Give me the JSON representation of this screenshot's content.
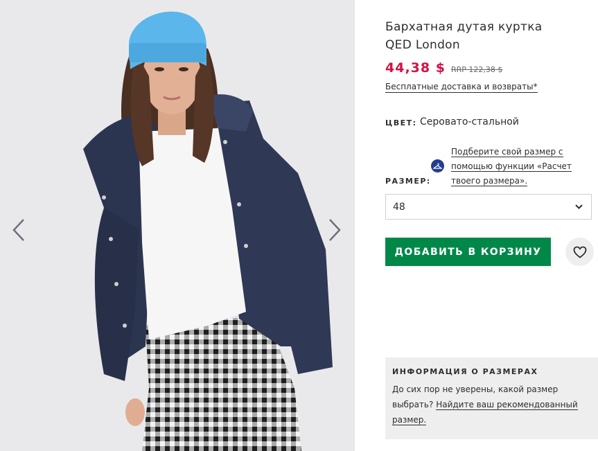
{
  "gallery": {
    "image_alt": "Model wearing navy velvet puffer jacket, white sweater, gingham trousers and blue beanie",
    "prev_icon": "chevron-left-icon",
    "next_icon": "chevron-right-icon"
  },
  "product": {
    "title_line1": "Бархатная дутая куртка",
    "title_line2": "QED London",
    "price": "44,38 $",
    "rrp": "RRP 122,38 $",
    "delivery_link": "Бесплатные доставка и возвраты*",
    "colour_label": "ЦВЕТ:",
    "colour_value": "Серовато-стальной",
    "size_label": "РАЗМЕР:",
    "fit_assistant_line1": "Подберите свой размер с",
    "fit_assistant_line2": "помощью функции «Расчет",
    "fit_assistant_line3": "твоего размера».",
    "size_selected": "48",
    "add_to_bag": "ДОБАВИТЬ В КОРЗИНУ",
    "wishlist_icon": "heart-icon"
  },
  "size_info": {
    "title": "ИНФОРМАЦИЯ О РАЗМЕРАХ",
    "text": "До сих пор не уверены, какой размер выбрать?",
    "link": "Найдите ваш рекомендованный размер."
  },
  "colors": {
    "price": "#d01345",
    "add_button": "#018849",
    "fit_icon": "#263c8e",
    "info_bg": "#eeeeee"
  }
}
